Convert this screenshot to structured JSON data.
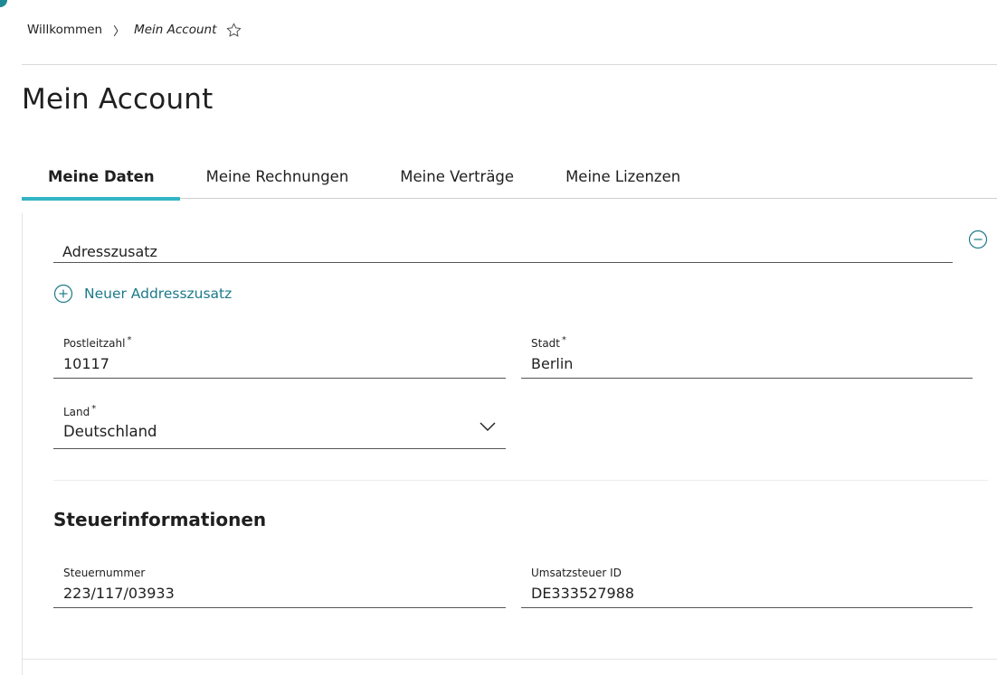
{
  "breadcrumb": {
    "home": "Willkommen",
    "separator": "〉",
    "current": "Mein Account"
  },
  "page": {
    "title": "Mein Account"
  },
  "tabs": [
    {
      "label": "Meine Daten",
      "active": true
    },
    {
      "label": "Meine Rechnungen",
      "active": false
    },
    {
      "label": "Meine Verträge",
      "active": false
    },
    {
      "label": "Meine Lizenzen",
      "active": false
    }
  ],
  "address": {
    "addition_value": "Adresszusatz",
    "add_addition_label": "Neuer Addresszusatz",
    "postal_code": {
      "label": "Postleitzahl",
      "required_mark": "*",
      "value": "10117"
    },
    "city": {
      "label": "Stadt",
      "required_mark": "*",
      "value": "Berlin"
    },
    "country": {
      "label": "Land",
      "required_mark": "*",
      "value": "Deutschland"
    }
  },
  "tax": {
    "heading": "Steuerinformationen",
    "tax_number": {
      "label": "Steuernummer",
      "value": "223/117/03933"
    },
    "vat_id": {
      "label": "Umsatzsteuer ID",
      "value": "DE333527988"
    }
  },
  "colors": {
    "accent_tab": "#33b5c5",
    "link": "#1d7a8a",
    "text": "#1f1f1f"
  },
  "icons": {
    "favorite": "star-outline-icon",
    "remove": "minus-circle-icon",
    "add": "plus-circle-icon",
    "dropdown": "chevron-down-icon"
  }
}
